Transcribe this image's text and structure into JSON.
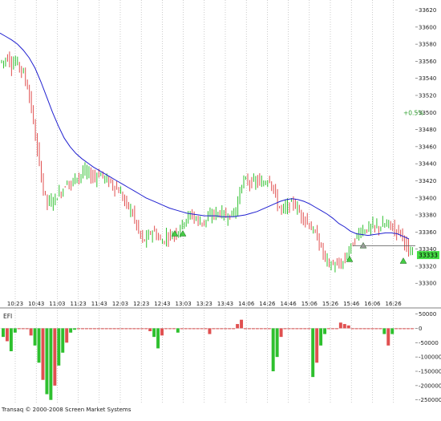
{
  "chart_data": [
    {
      "type": "candlestick",
      "role": "price-panel",
      "y_ticks": [
        33300,
        33320,
        33340,
        33360,
        33380,
        33400,
        33420,
        33440,
        33460,
        33480,
        33500,
        33520,
        33540,
        33560,
        33580,
        33600,
        33620
      ],
      "ylim": [
        33288,
        33628
      ],
      "x_tick_labels": [
        "10:23",
        "10:43",
        "11:03",
        "11:23",
        "11:43",
        "12:03",
        "12:23",
        "12:43",
        "13:03",
        "13:23",
        "13:43",
        "14:06",
        "14:26",
        "14:46",
        "15:06",
        "15:26",
        "15:46",
        "16:06",
        "16:26"
      ],
      "last_price": 33333,
      "last_price_label": "33333",
      "percent_label": "+0.5%",
      "percent_label_level": 33500,
      "horizontal_level": 33344,
      "close_series": [
        33560,
        33565,
        33555,
        33560,
        33555,
        33545,
        33530,
        33505,
        33470,
        33440,
        33410,
        33395,
        33395,
        33400,
        33405,
        33410,
        33420,
        33415,
        33425,
        33425,
        33430,
        33430,
        33425,
        33425,
        33428,
        33426,
        33420,
        33418,
        33412,
        33408,
        33400,
        33392,
        33386,
        33375,
        33360,
        33350,
        33352,
        33360,
        33360,
        33352,
        33348,
        33355,
        33356,
        33358,
        33362,
        33370,
        33376,
        33380,
        33378,
        33372,
        33372,
        33374,
        33378,
        33382,
        33382,
        33382,
        33378,
        33380,
        33382,
        33395,
        33418,
        33420,
        33418,
        33418,
        33420,
        33415,
        33420,
        33422,
        33410,
        33392,
        33386,
        33388,
        33392,
        33395,
        33386,
        33380,
        33375,
        33368,
        33360,
        33354,
        33340,
        33330,
        33322,
        33322,
        33320,
        33322,
        33328,
        33340,
        33346,
        33356,
        33362,
        33362,
        33365,
        33366,
        33366,
        33366,
        33368,
        33370,
        33364,
        33362,
        33360,
        33350,
        33335,
        33333
      ],
      "moving_average_series": [
        33593,
        33589,
        33585,
        33580,
        33573,
        33564,
        33552,
        33536,
        33518,
        33500,
        33484,
        33470,
        33460,
        33452,
        33446,
        33441,
        33436,
        33432,
        33428,
        33424,
        33420,
        33416,
        33412,
        33408,
        33404,
        33400,
        33397,
        33394,
        33391,
        33388,
        33386,
        33384,
        33382,
        33381,
        33380,
        33379,
        33379,
        33379,
        33378,
        33378,
        33378,
        33379,
        33380,
        33382,
        33384,
        33387,
        33390,
        33393,
        33396,
        33398,
        33399,
        33398,
        33396,
        33393,
        33389,
        33385,
        33381,
        33376,
        33370,
        33366,
        33361,
        33358,
        33357,
        33356,
        33357,
        33358,
        33359,
        33359,
        33358,
        33355,
        33352
      ]
    },
    {
      "type": "bar",
      "role": "indicator-panel",
      "indicator_name": "EFI",
      "y_ticks": [
        50000,
        0,
        -50000,
        -100000,
        -150000,
        -200000,
        -250000
      ],
      "ylim": [
        -262000,
        60000
      ],
      "values": [
        -30000,
        -45000,
        -80000,
        -15000,
        0,
        0,
        0,
        -25000,
        -60000,
        -120000,
        -180000,
        -230000,
        -250000,
        -200000,
        -130000,
        -85000,
        -50000,
        -15000,
        -5000,
        0,
        0,
        0,
        0,
        0,
        0,
        0,
        0,
        0,
        0,
        0,
        0,
        0,
        0,
        0,
        0,
        0,
        0,
        -10000,
        -30000,
        -70000,
        -25000,
        0,
        0,
        0,
        -15000,
        0,
        0,
        0,
        0,
        0,
        0,
        0,
        -20000,
        0,
        0,
        0,
        0,
        0,
        0,
        15000,
        30000,
        0,
        0,
        0,
        0,
        0,
        0,
        0,
        -150000,
        -100000,
        -30000,
        0,
        0,
        0,
        0,
        0,
        0,
        0,
        -170000,
        -120000,
        -60000,
        -20000,
        0,
        0,
        0,
        20000,
        15000,
        10000,
        0,
        0,
        0,
        0,
        0,
        0,
        0,
        0,
        -20000,
        -60000,
        -20000,
        0,
        0,
        0,
        0,
        0
      ]
    }
  ],
  "indicator_label": "EFI",
  "copyright": "Transaq © 2000-2008 Screen Market Systems",
  "colors": {
    "up": "#2ec02e",
    "down": "#e05050",
    "moving_average": "#2020d0",
    "axis_text": "#222222",
    "grid_vertical": "#aaaaaa",
    "percent_label": "#2ea02e",
    "separator": "#808080"
  }
}
